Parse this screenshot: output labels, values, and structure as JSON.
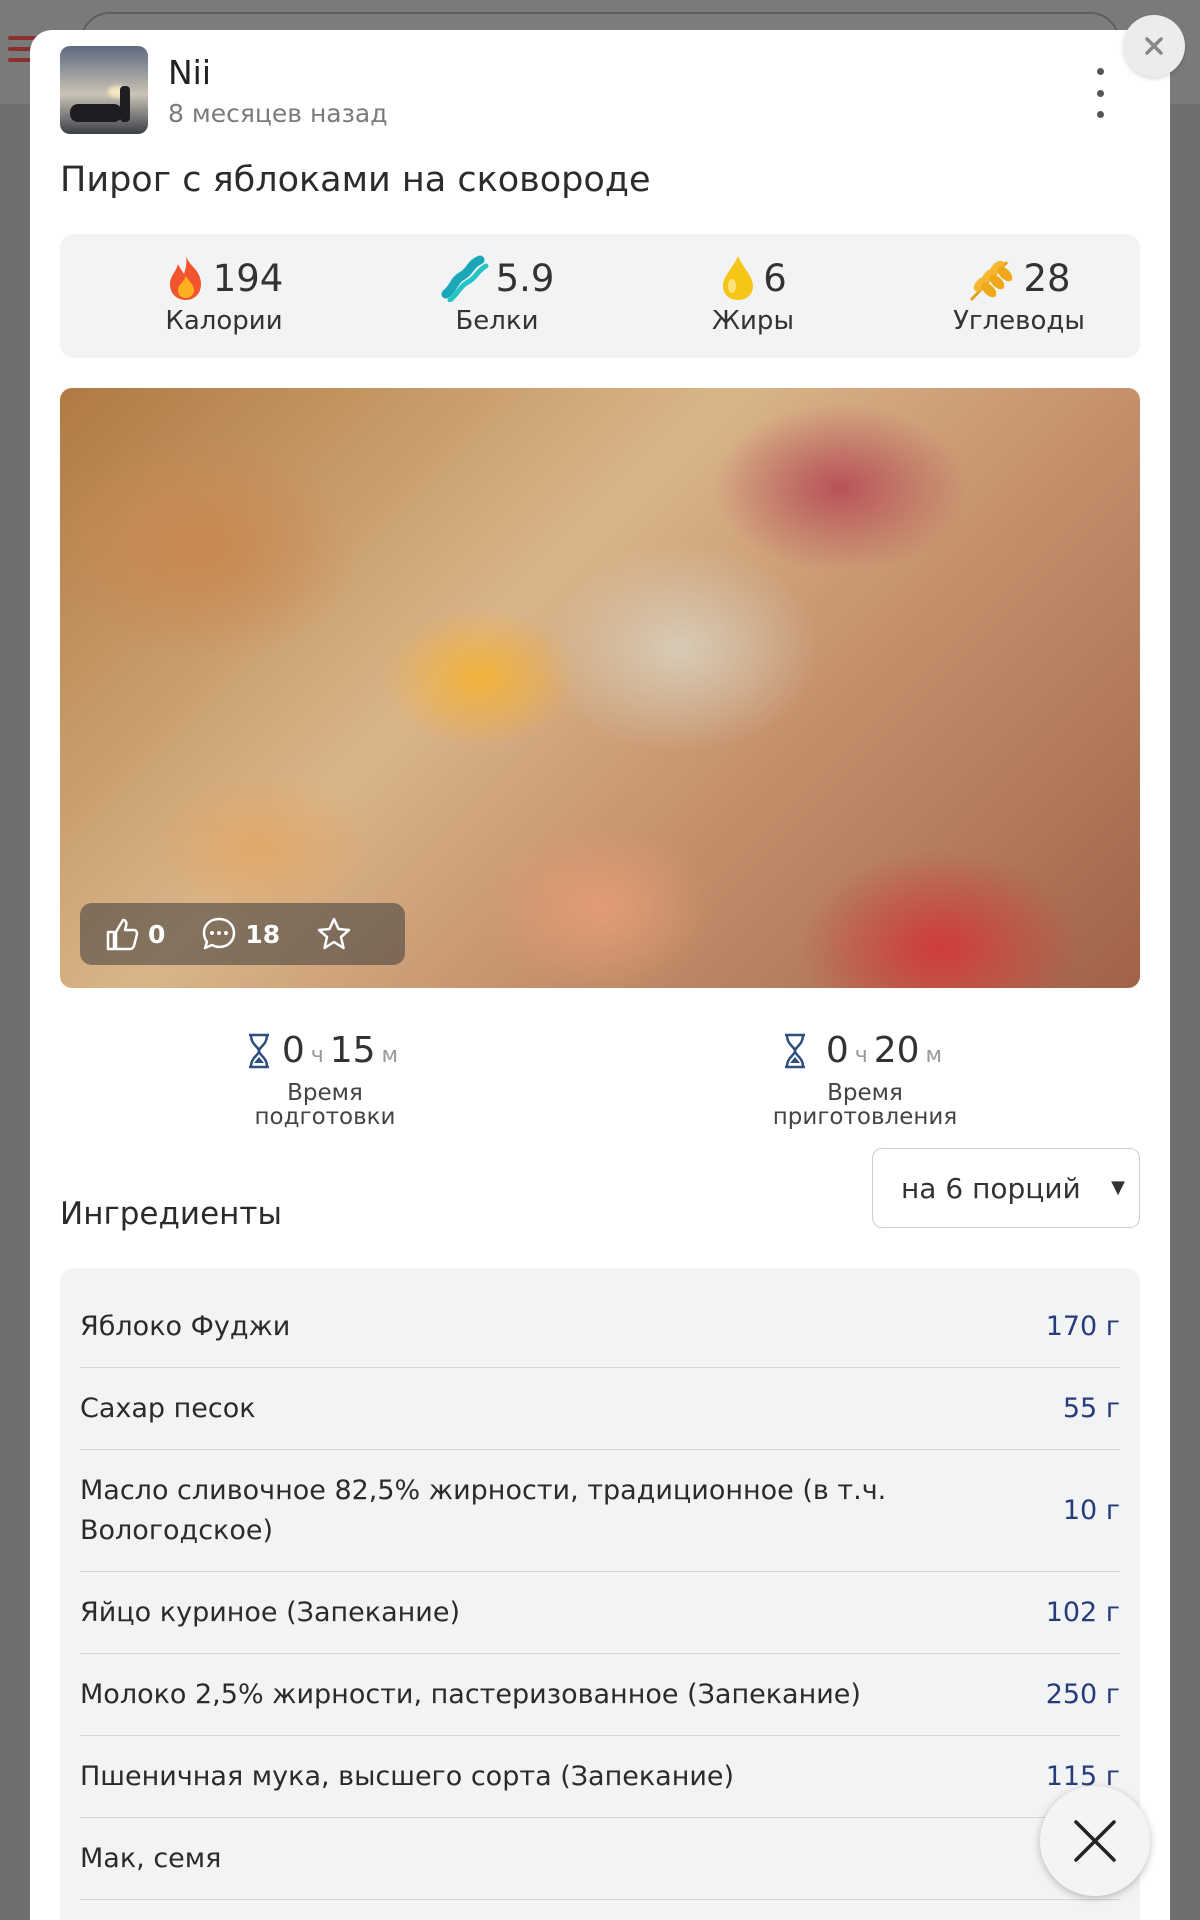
{
  "author": {
    "name": "Nii",
    "time_ago": "8 месяцев назад"
  },
  "recipe": {
    "title": "Пирог с яблоками на сковороде"
  },
  "nutrition": [
    {
      "icon": "flame-icon",
      "value": "194",
      "label": "Калории"
    },
    {
      "icon": "protein-icon",
      "value": "5.9",
      "label": "Белки"
    },
    {
      "icon": "oil-drop-icon",
      "value": "6",
      "label": "Жиры"
    },
    {
      "icon": "wheat-icon",
      "value": "28",
      "label": "Углеводы"
    }
  ],
  "photo_actions": {
    "likes": "0",
    "comments": "18"
  },
  "times": {
    "prep": {
      "hours": "0",
      "hours_unit": "ч",
      "minutes": "15",
      "minutes_unit": "м",
      "label_line1": "Время",
      "label_line2": "подготовки"
    },
    "cook": {
      "hours": "0",
      "hours_unit": "ч",
      "minutes": "20",
      "minutes_unit": "м",
      "label_line1": "Время",
      "label_line2": "приготовления"
    }
  },
  "ingredients": {
    "title": "Ингредиенты",
    "portion_select": "на 6 порций",
    "items": [
      {
        "name": "Яблоко Фуджи",
        "amount": "170 г"
      },
      {
        "name": "Сахар песок",
        "amount": "55 г"
      },
      {
        "name": "Масло сливочное 82,5% жирности, традиционное (в т.ч. Вологодское)",
        "amount": "10 г"
      },
      {
        "name": "Яйцо куриное (Запекание)",
        "amount": "102 г"
      },
      {
        "name": "Молоко 2,5% жирности, пастеризованное (Запекание)",
        "amount": "250 г"
      },
      {
        "name": "Пшеничная мука, высшего сорта (Запекание)",
        "amount": "115 г"
      },
      {
        "name": "Мак, семя",
        "amount": ""
      }
    ]
  },
  "colors": {
    "amount": "#283c7a",
    "panel": "#f2f3f5"
  }
}
